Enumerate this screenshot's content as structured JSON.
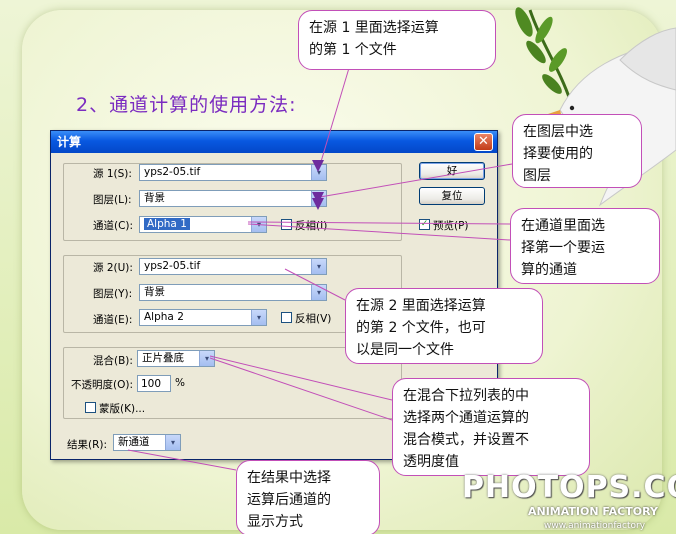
{
  "heading": "2、通道计算的使用方法:",
  "dialog": {
    "title": "计算",
    "close_glyph": "✕",
    "source1": {
      "label": "源 1(S):",
      "value": "yps2-05.tif",
      "layer_label": "图层(L):",
      "layer_value": "背景",
      "channel_label": "通道(C):",
      "channel_value": "Alpha 1",
      "invert_label": "反相(I)"
    },
    "source2": {
      "label": "源 2(U):",
      "value": "yps2-05.tif",
      "layer_label": "图层(Y):",
      "layer_value": "背景",
      "channel_label": "通道(E):",
      "channel_value": "Alpha 2",
      "invert_label": "反相(V)"
    },
    "blend": {
      "label": "混合(B):",
      "value": "正片叠底",
      "opacity_label": "不透明度(O):",
      "opacity_value": "100",
      "opacity_unit": "%",
      "mask_label": "蒙版(K)..."
    },
    "result": {
      "label": "结果(R):",
      "value": "新通道"
    },
    "buttons": {
      "ok": "好",
      "reset": "复位"
    },
    "preview_label": "预览(P)",
    "preview_checked": "✓",
    "dropdown_glyph": "▾"
  },
  "callouts": {
    "c1": [
      "在源 1 里面选择运算",
      "的第 1 个文件"
    ],
    "c2": [
      "在图层中选",
      "择要使用的",
      "图层"
    ],
    "c3": [
      "在通道里面选",
      "择第一个要运",
      "算的通道"
    ],
    "c4": [
      "在源 2 里面选择运算",
      "的第 2 个文件，也可",
      "以是同一个文件"
    ],
    "c5": [
      "在混合下拉列表的中",
      "选择两个通道运算的",
      "混合模式，并设置不",
      "透明度值"
    ],
    "c6": [
      "在结果中选择",
      "运算后通道的",
      "显示方式"
    ]
  },
  "watermark": {
    "main": "PHOTOPS.COM",
    "sub": "ANIMATION FACTORY",
    "url": "www.animationfactory"
  },
  "colors": {
    "heading": "#7b2cc0",
    "callout_border": "#c24fb8",
    "titlebar": "#0858e0"
  }
}
